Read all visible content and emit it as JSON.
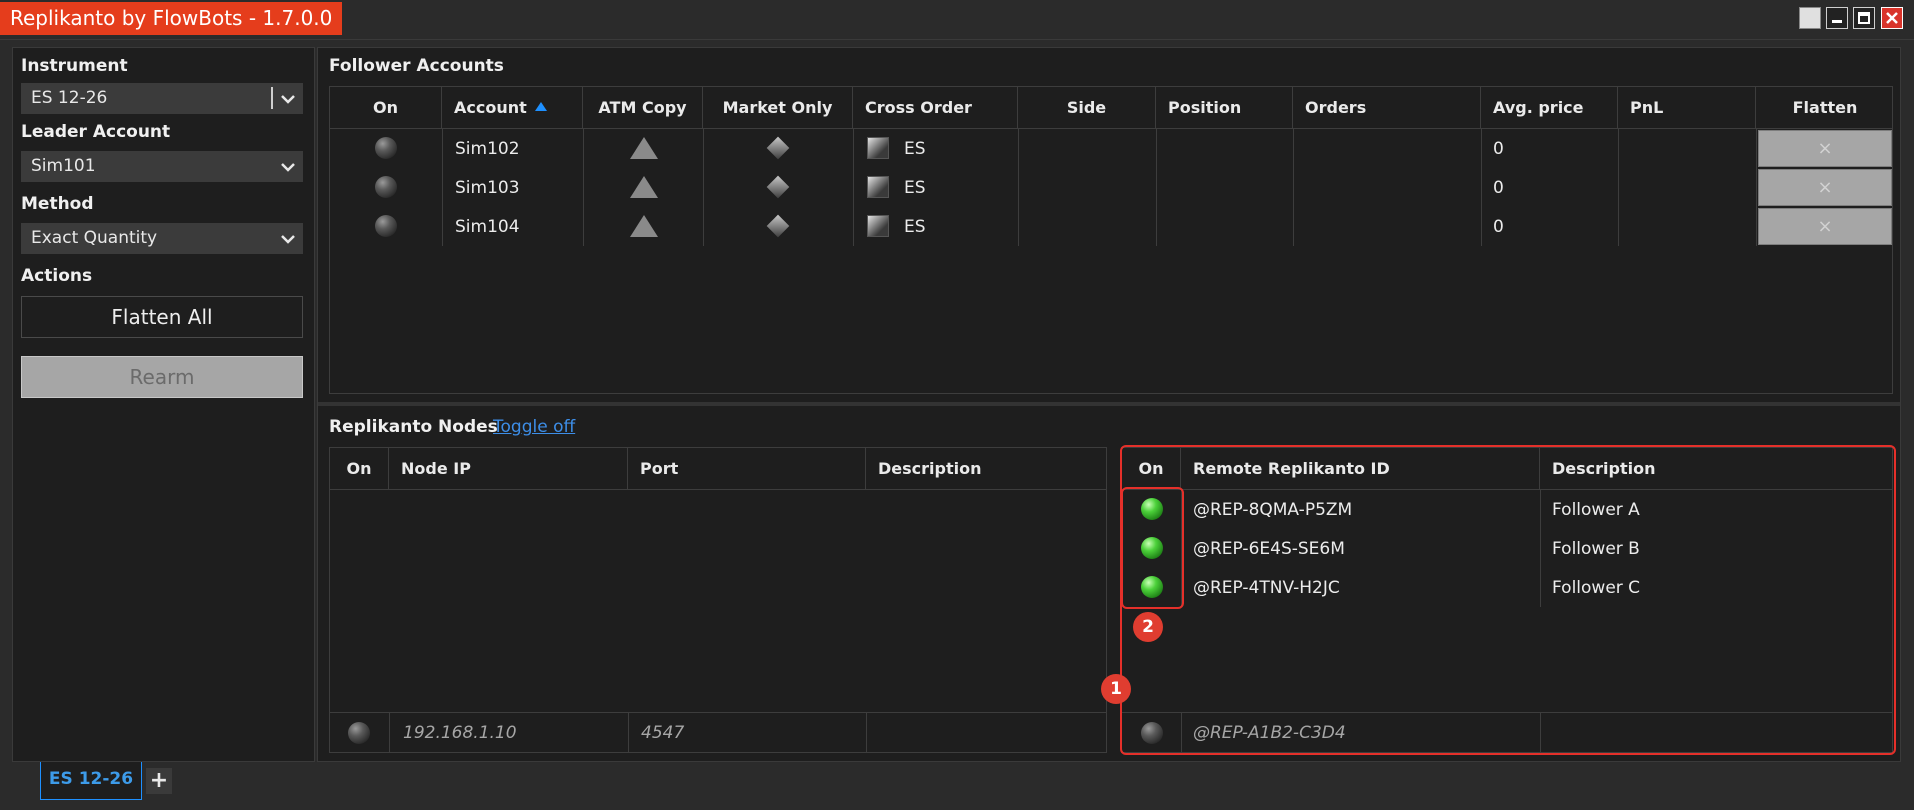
{
  "window": {
    "title": "Replikanto by FlowBots - 1.7.0.0",
    "controls": [
      "blank",
      "minimize",
      "maximize",
      "close"
    ]
  },
  "sidebar": {
    "instrument_label": "Instrument",
    "instrument_value": "ES 12-26",
    "leader_label": "Leader Account",
    "leader_value": "Sim101",
    "method_label": "Method",
    "method_value": "Exact Quantity",
    "actions_label": "Actions",
    "flatten_all_label": "Flatten All",
    "rearm_label": "Rearm"
  },
  "followers": {
    "title": "Follower Accounts",
    "columns": [
      "On",
      "Account",
      "ATM Copy",
      "Market Only",
      "Cross Order",
      "Side",
      "Position",
      "Orders",
      "Avg. price",
      "PnL",
      "Flatten"
    ],
    "sort_column": "Account",
    "sort_direction": "ascending",
    "rows": [
      {
        "on": false,
        "account": "Sim102",
        "cross_order": "ES",
        "side": "",
        "position": "",
        "orders": "",
        "avg_price": "0",
        "pnl": "",
        "flatten": "×"
      },
      {
        "on": false,
        "account": "Sim103",
        "cross_order": "ES",
        "side": "",
        "position": "",
        "orders": "",
        "avg_price": "0",
        "pnl": "",
        "flatten": "×"
      },
      {
        "on": false,
        "account": "Sim104",
        "cross_order": "ES",
        "side": "",
        "position": "",
        "orders": "",
        "avg_price": "0",
        "pnl": "",
        "flatten": "×"
      }
    ]
  },
  "nodes": {
    "title": "Replikanto Nodes",
    "toggle_link": "Toggle off",
    "left_columns": [
      "On",
      "Node IP",
      "Port",
      "Description"
    ],
    "right_columns": [
      "On",
      "Remote Replikanto ID",
      "Description"
    ],
    "remote_rows": [
      {
        "on": true,
        "id": "@REP-8QMA-P5ZM",
        "description": "Follower A"
      },
      {
        "on": true,
        "id": "@REP-6E4S-SE6M",
        "description": "Follower B"
      },
      {
        "on": true,
        "id": "@REP-4TNV-H2JC",
        "description": "Follower C"
      }
    ],
    "new_node_row": {
      "on": false,
      "ip": "192.168.1.10",
      "port": "4547",
      "description": ""
    },
    "new_remote_row": {
      "on": false,
      "id": "@REP-A1B2-C3D4",
      "description": ""
    }
  },
  "annotations": {
    "badge_1": "1",
    "badge_2": "2",
    "color": "#e5302a"
  },
  "tabs": {
    "active": "ES 12-26",
    "add_label": "+"
  },
  "colors": {
    "accent": "#e53d1c",
    "link": "#3d8ee8",
    "active_tab": "#1e90ff",
    "status_on": "#4cd13a"
  }
}
